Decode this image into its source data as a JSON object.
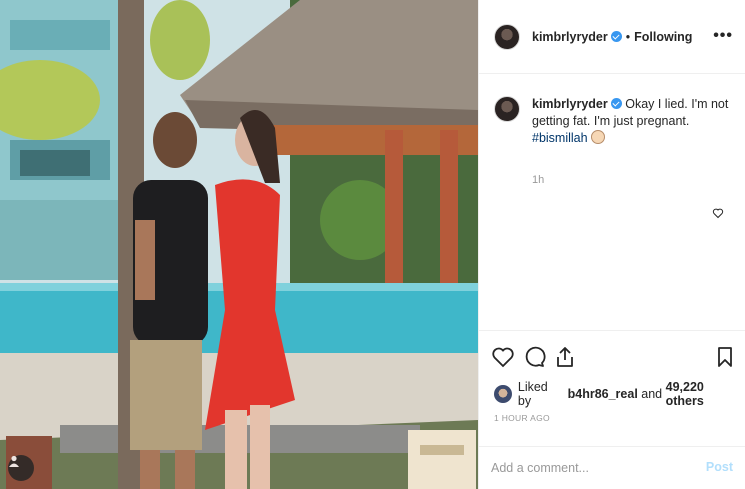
{
  "post": {
    "author": {
      "username": "kimbrlyryder",
      "verified": true
    },
    "header": {
      "separator": "•",
      "follow_label": "Following",
      "more_label": "•••"
    },
    "caption": {
      "username": "kimbrlyryder",
      "text": "Okay I lied. I'm not getting fat. I'm just pregnant.",
      "hashtag": "#bismillah"
    },
    "caption_time": "1h",
    "likes": {
      "prefix": "Liked by",
      "user": "b4hr86_real",
      "connector": "and",
      "others": "49,220 others"
    },
    "posted_time": "1 HOUR AGO",
    "comment": {
      "placeholder": "Add a comment...",
      "post_label": "Post"
    }
  },
  "icons": {
    "like": "heart-icon",
    "comment": "comment-icon",
    "share": "share-icon",
    "save": "bookmark-icon",
    "more": "more-options-icon",
    "user_tag": "user-tag-icon",
    "verified": "verified-badge-icon"
  },
  "colors": {
    "verified_badge": "#3897f0",
    "post_button": "#b2dffc",
    "hashtag": "#003569",
    "dress": "#e2362d"
  }
}
